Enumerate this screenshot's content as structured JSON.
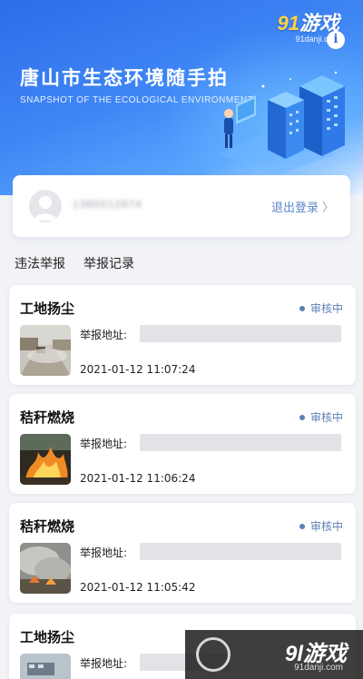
{
  "banner": {
    "title": "唐山市生态环境随手拍",
    "subtitle": "SNAPSHOT OF THE ECOLOGICAL ENVIRONMENT"
  },
  "watermark_top": {
    "brand_num": "91",
    "brand_text": "游戏",
    "url": "91danji.com"
  },
  "info_icon": {
    "glyph": "i",
    "icon": "info-icon"
  },
  "user": {
    "username": "1385012974",
    "logout_label": "退出登录",
    "chevron": "〉"
  },
  "tabs": [
    {
      "label": "违法举报",
      "active": false
    },
    {
      "label": "举报记录",
      "active": true
    }
  ],
  "reports": [
    {
      "title": "工地扬尘",
      "status": "审核中",
      "address_label": "举报地址:",
      "time": "2021-01-12 11:07:24"
    },
    {
      "title": "秸秆燃烧",
      "status": "审核中",
      "address_label": "举报地址:",
      "time": "2021-01-12 11:06:24"
    },
    {
      "title": "秸秆燃烧",
      "status": "审核中",
      "address_label": "举报地址:",
      "time": "2021-01-12 11:05:42"
    },
    {
      "title": "工地扬尘",
      "status": "",
      "address_label": "举报地址:",
      "time": ""
    }
  ],
  "watermark_bottom": {
    "brand": "9l游戏",
    "url": "91danji.com"
  },
  "colors": {
    "accent": "#5b7fb6",
    "banner_start": "#2d6ce8",
    "banner_end": "#5aa6ff"
  }
}
